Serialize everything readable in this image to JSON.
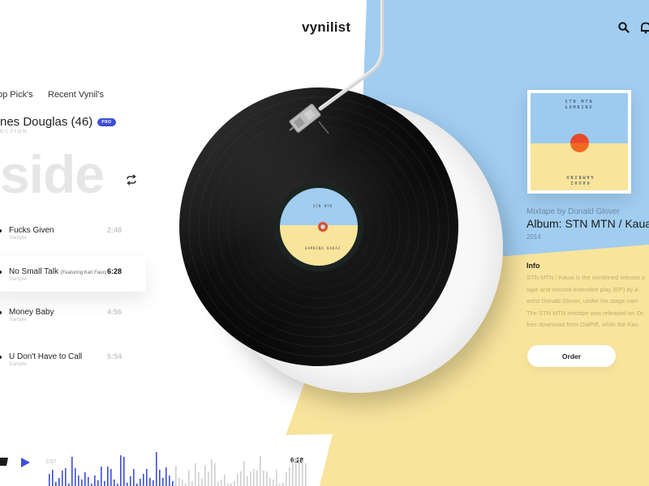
{
  "app": {
    "title": "vynilist"
  },
  "header": {
    "icons": [
      "search-icon",
      "bell-icon"
    ]
  },
  "nav": {
    "tabs": [
      {
        "label": "op Pick's"
      },
      {
        "label": "Recent Vynil's"
      }
    ]
  },
  "profile": {
    "name": "nes Douglas (46)",
    "badge": "PRO",
    "section": "ECTION"
  },
  "side": {
    "title": "side",
    "repeat_icon": "repeat-icon"
  },
  "tracks": [
    {
      "title": "Fucks Given",
      "feat": "",
      "subtitle": "Sample",
      "duration": "2:48",
      "active": false
    },
    {
      "title": "No Small Talk",
      "feat": "(Featuring Kari Faux)",
      "subtitle": "Sample",
      "duration": "6:28",
      "active": true
    },
    {
      "title": "Money Baby",
      "feat": "",
      "subtitle": "Sample",
      "duration": "4:56",
      "active": false
    },
    {
      "title": "U Don't Have to Call",
      "feat": "",
      "subtitle": "Sample",
      "duration": "5:54",
      "active": false
    }
  ],
  "player": {
    "current_time": "3:07",
    "total_time": "6:28",
    "progress": 0.48
  },
  "record_label": {
    "top_text": "STN MTN",
    "bottom_text": "GAMBINO  KAUAI"
  },
  "album": {
    "cover_top": "STN MTN\nGAMBINO",
    "cover_bottom": "KAUAI\nGAMBINO",
    "mixtape_by": "Mixtape by Donald Glover",
    "title": "Album: STN MTN / Kauai",
    "year": "2014",
    "info_heading": "Info",
    "info_text": "STN MTN / Kauai is the combined release o\ntape and second extended play (EP) by A\nartist Donald Glover, under his stage nam\nThe STN MTN mixtape was released on Oc\nfree download from DatPiff, while the Kau",
    "order_label": "Order"
  },
  "colors": {
    "sky": "#a0cdf0",
    "sand": "#f9e49c",
    "accent": "#3d4fd6",
    "record": "#0c0c0c"
  }
}
